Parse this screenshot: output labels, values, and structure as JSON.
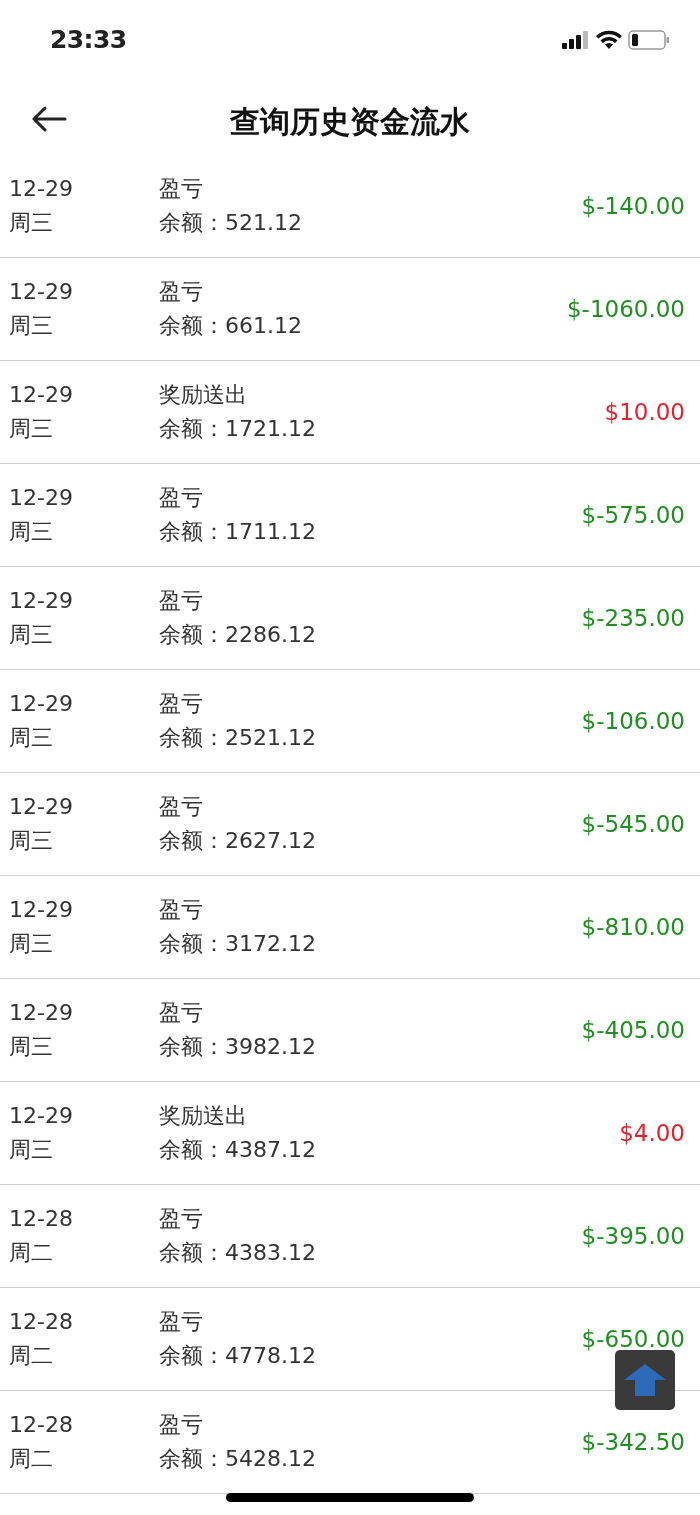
{
  "status_bar": {
    "time": "23:33"
  },
  "header": {
    "title": "查询历史资金流水"
  },
  "rows": [
    {
      "date": "12-29",
      "weekday": "周三",
      "type": "盈亏",
      "balance": "余额：521.12",
      "amount": "$-140.00",
      "kind": "loss"
    },
    {
      "date": "12-29",
      "weekday": "周三",
      "type": "盈亏",
      "balance": "余额：661.12",
      "amount": "$-1060.00",
      "kind": "loss"
    },
    {
      "date": "12-29",
      "weekday": "周三",
      "type": "奖励送出",
      "balance": "余额：1721.12",
      "amount": "$10.00",
      "kind": "reward"
    },
    {
      "date": "12-29",
      "weekday": "周三",
      "type": "盈亏",
      "balance": "余额：1711.12",
      "amount": "$-575.00",
      "kind": "loss"
    },
    {
      "date": "12-29",
      "weekday": "周三",
      "type": "盈亏",
      "balance": "余额：2286.12",
      "amount": "$-235.00",
      "kind": "loss"
    },
    {
      "date": "12-29",
      "weekday": "周三",
      "type": "盈亏",
      "balance": "余额：2521.12",
      "amount": "$-106.00",
      "kind": "loss"
    },
    {
      "date": "12-29",
      "weekday": "周三",
      "type": "盈亏",
      "balance": "余额：2627.12",
      "amount": "$-545.00",
      "kind": "loss"
    },
    {
      "date": "12-29",
      "weekday": "周三",
      "type": "盈亏",
      "balance": "余额：3172.12",
      "amount": "$-810.00",
      "kind": "loss"
    },
    {
      "date": "12-29",
      "weekday": "周三",
      "type": "盈亏",
      "balance": "余额：3982.12",
      "amount": "$-405.00",
      "kind": "loss"
    },
    {
      "date": "12-29",
      "weekday": "周三",
      "type": "奖励送出",
      "balance": "余额：4387.12",
      "amount": "$4.00",
      "kind": "reward"
    },
    {
      "date": "12-28",
      "weekday": "周二",
      "type": "盈亏",
      "balance": "余额：4383.12",
      "amount": "$-395.00",
      "kind": "loss"
    },
    {
      "date": "12-28",
      "weekday": "周二",
      "type": "盈亏",
      "balance": "余额：4778.12",
      "amount": "$-650.00",
      "kind": "loss"
    },
    {
      "date": "12-28",
      "weekday": "周二",
      "type": "盈亏",
      "balance": "余额：5428.12",
      "amount": "$-342.50",
      "kind": "loss"
    }
  ]
}
